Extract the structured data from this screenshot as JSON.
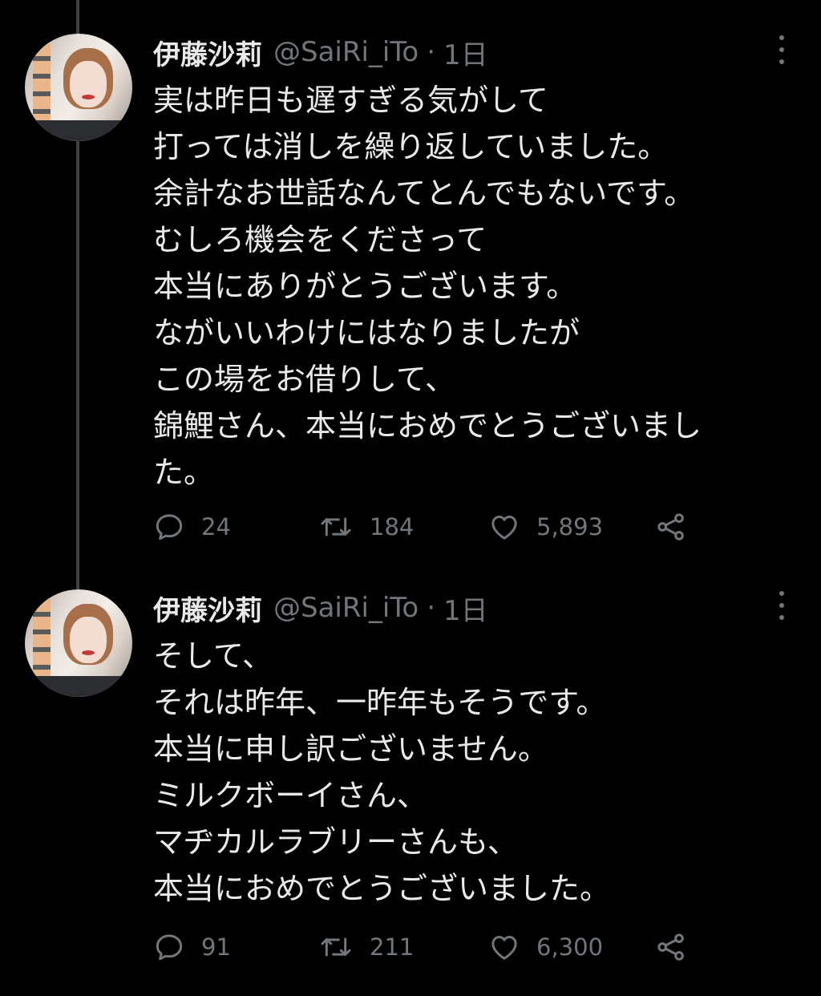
{
  "colors": {
    "background": "#000000",
    "text_primary": "#e7e9ea",
    "text_secondary": "#71767b",
    "thread_line": "#3e4144"
  },
  "tweets": [
    {
      "author": "伊藤沙莉",
      "handle": "@SaiRi_iTo",
      "separator": "·",
      "time": "1日",
      "avatar_icon": "profile-photo",
      "more_icon": "more-vertical-icon",
      "lines": [
        "実は昨日も遅すぎる気がして",
        "打っては消しを繰り返していました。",
        "余計なお世話なんてとんでもないです。",
        "むしろ機会をくださって",
        "本当にありがとうございます。",
        "ながいいわけにはなりましたが",
        "この場をお借りして、",
        "錦鯉さん、本当におめでとうございまし",
        "た。"
      ],
      "replies": "24",
      "retweets": "184",
      "likes": "5,893"
    },
    {
      "author": "伊藤沙莉",
      "handle": "@SaiRi_iTo",
      "separator": "·",
      "time": "1日",
      "avatar_icon": "profile-photo",
      "more_icon": "more-vertical-icon",
      "lines": [
        "そして、",
        "それは昨年、一昨年もそうです。",
        "本当に申し訳ございません。",
        "ミルクボーイさん、",
        "マヂカルラブリーさんも、",
        "本当におめでとうございました。"
      ],
      "replies": "91",
      "retweets": "211",
      "likes": "6,300"
    }
  ]
}
